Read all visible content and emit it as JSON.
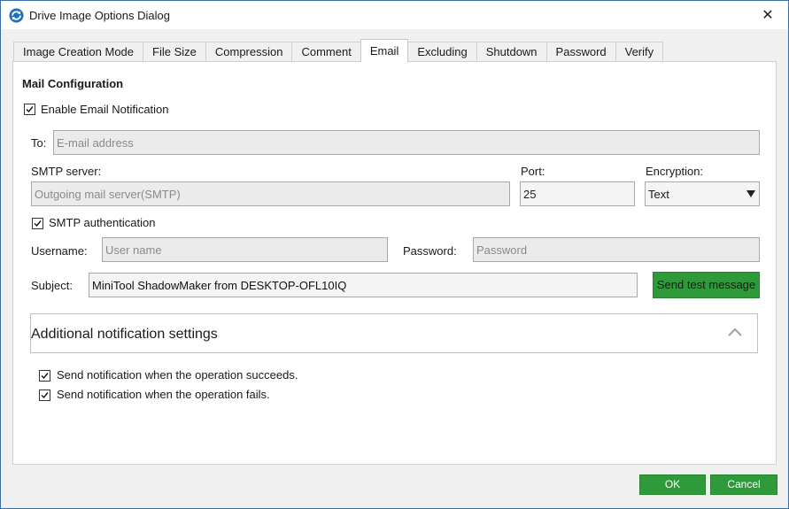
{
  "window": {
    "title": "Drive Image Options Dialog",
    "close_glyph": "✕"
  },
  "tabs": [
    {
      "label": "Image Creation Mode"
    },
    {
      "label": "File Size"
    },
    {
      "label": "Compression"
    },
    {
      "label": "Comment"
    },
    {
      "label": "Email"
    },
    {
      "label": "Excluding"
    },
    {
      "label": "Shutdown"
    },
    {
      "label": "Password"
    },
    {
      "label": "Verify"
    }
  ],
  "active_tab": "Email",
  "mail": {
    "section_title": "Mail Configuration",
    "enable_label": "Enable Email Notification",
    "enable_checked": true,
    "to_label": "To:",
    "to_placeholder": "E-mail address",
    "smtp_label": "SMTP server:",
    "smtp_placeholder": "Outgoing mail server(SMTP)",
    "port_label": "Port:",
    "port_value": "25",
    "encryption_label": "Encryption:",
    "encryption_value": "Text",
    "auth_label": "SMTP authentication",
    "auth_checked": true,
    "username_label": "Username:",
    "username_placeholder": "User name",
    "password_label": "Password:",
    "password_placeholder": "Password",
    "subject_label": "Subject:",
    "subject_value": "MiniTool ShadowMaker from DESKTOP-OFL10IQ",
    "send_test_label": "Send test message"
  },
  "additional": {
    "title": "Additional notification settings",
    "succeed_label": "Send notification when the operation succeeds.",
    "succeed_checked": true,
    "fail_label": "Send notification when the operation fails.",
    "fail_checked": true
  },
  "footer": {
    "ok_label": "OK",
    "cancel_label": "Cancel"
  },
  "colors": {
    "accent_green": "#2e9a3a",
    "window_border": "#3a6ea5"
  }
}
